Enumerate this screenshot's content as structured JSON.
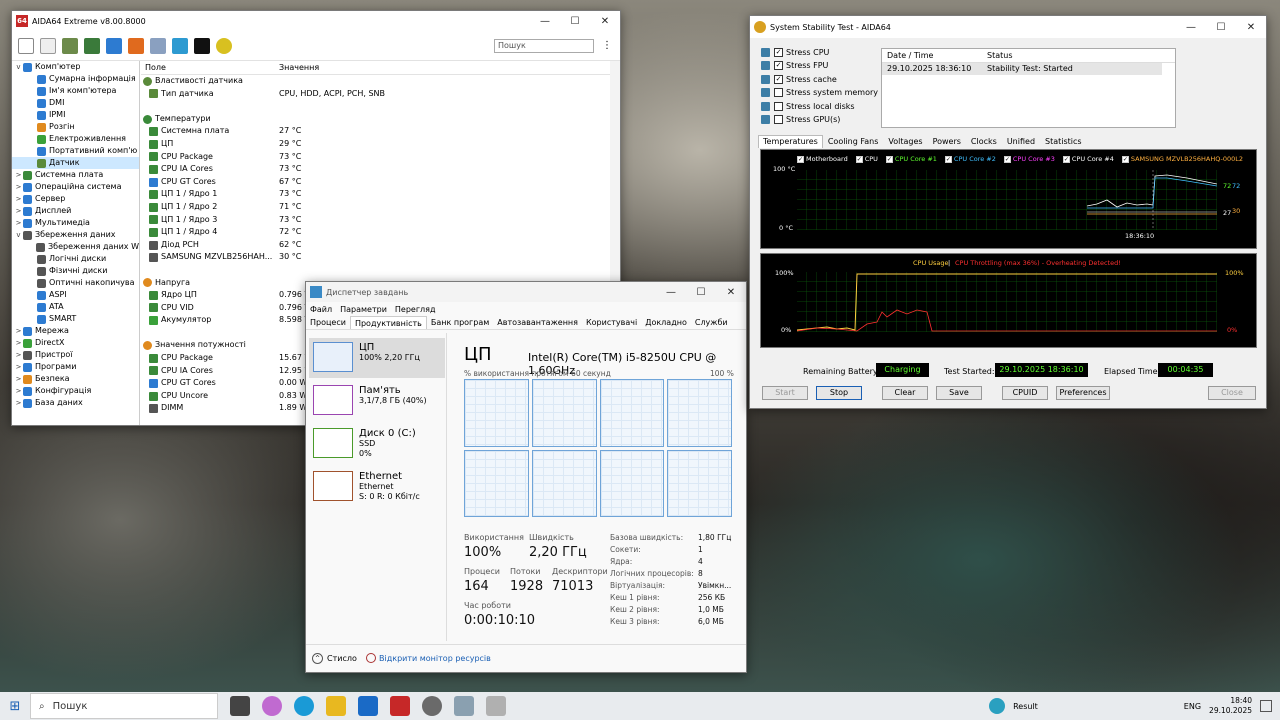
{
  "aida": {
    "title": "AIDA64 Extreme v8.00.8000",
    "logo": "64",
    "search_placeholder": "Пошук",
    "col_field": "Поле",
    "col_value": "Значення",
    "tree": [
      {
        "label": "Комп'ютер",
        "lvl": 0,
        "ex": "v",
        "color": "#2d7bd1"
      },
      {
        "label": "Сумарна інформація",
        "lvl": 1,
        "ex": "",
        "color": "#2d7bd1"
      },
      {
        "label": "Ім'я комп'ютера",
        "lvl": 1,
        "ex": "",
        "color": "#2d7bd1"
      },
      {
        "label": "DMI",
        "lvl": 1,
        "ex": "",
        "color": "#2d7bd1"
      },
      {
        "label": "IPMI",
        "lvl": 1,
        "ex": "",
        "color": "#2d7bd1"
      },
      {
        "label": "Розгін",
        "lvl": 1,
        "ex": "",
        "color": "#e08a1e"
      },
      {
        "label": "Електроживлення",
        "lvl": 1,
        "ex": "",
        "color": "#3aa13a"
      },
      {
        "label": "Портативний комп'ю",
        "lvl": 1,
        "ex": "",
        "color": "#2d7bd1"
      },
      {
        "label": "Датчик",
        "lvl": 1,
        "ex": "",
        "color": "#5a8a3a",
        "sel": true
      },
      {
        "label": "Системна плата",
        "lvl": 0,
        "ex": ">",
        "color": "#3a8a3a"
      },
      {
        "label": "Операційна система",
        "lvl": 0,
        "ex": ">",
        "color": "#2d7bd1"
      },
      {
        "label": "Сервер",
        "lvl": 0,
        "ex": ">",
        "color": "#2d7bd1"
      },
      {
        "label": "Дисплей",
        "lvl": 0,
        "ex": ">",
        "color": "#2d7bd1"
      },
      {
        "label": "Мультимедіа",
        "lvl": 0,
        "ex": ">",
        "color": "#2d7bd1"
      },
      {
        "label": "Збереження даних",
        "lvl": 0,
        "ex": "v",
        "color": "#555555"
      },
      {
        "label": "Збереження даних W",
        "lvl": 1,
        "ex": "",
        "color": "#555555"
      },
      {
        "label": "Логічні диски",
        "lvl": 1,
        "ex": "",
        "color": "#555555"
      },
      {
        "label": "Фізичні диски",
        "lvl": 1,
        "ex": "",
        "color": "#555555"
      },
      {
        "label": "Оптичні накопичува",
        "lvl": 1,
        "ex": "",
        "color": "#555555"
      },
      {
        "label": "ASPI",
        "lvl": 1,
        "ex": "",
        "color": "#2d7bd1"
      },
      {
        "label": "ATA",
        "lvl": 1,
        "ex": "",
        "color": "#2d7bd1"
      },
      {
        "label": "SMART",
        "lvl": 1,
        "ex": "",
        "color": "#2d7bd1"
      },
      {
        "label": "Мережа",
        "lvl": 0,
        "ex": ">",
        "color": "#2d7bd1"
      },
      {
        "label": "DirectX",
        "lvl": 0,
        "ex": ">",
        "color": "#3aa13a"
      },
      {
        "label": "Пристрої",
        "lvl": 0,
        "ex": ">",
        "color": "#555555"
      },
      {
        "label": "Програми",
        "lvl": 0,
        "ex": ">",
        "color": "#2d7bd1"
      },
      {
        "label": "Безпека",
        "lvl": 0,
        "ex": ">",
        "color": "#e08a1e"
      },
      {
        "label": "Конфігурація",
        "lvl": 0,
        "ex": ">",
        "color": "#2d7bd1"
      },
      {
        "label": "База даних",
        "lvl": 0,
        "ex": ">",
        "color": "#2d7bd1"
      }
    ],
    "rows": [
      {
        "f": "Властивості датчика",
        "v": "",
        "sec": true,
        "color": "#5a8a3a"
      },
      {
        "f": "Тип датчика",
        "v": "CPU, HDD, ACPI, PCH, SNB",
        "color": "#5a8a3a"
      },
      {
        "f": "",
        "v": ""
      },
      {
        "f": "Температури",
        "v": "",
        "sec": true,
        "color": "#3a8a3a"
      },
      {
        "f": "Системна плата",
        "v": "27 °C",
        "color": "#3a8a3a"
      },
      {
        "f": "ЦП",
        "v": "29 °C",
        "color": "#3a8a3a"
      },
      {
        "f": "CPU Package",
        "v": "73 °C",
        "color": "#3a8a3a"
      },
      {
        "f": "CPU IA Cores",
        "v": "73 °C",
        "color": "#3a8a3a"
      },
      {
        "f": "CPU GT Cores",
        "v": "67 °C",
        "color": "#2d7bd1"
      },
      {
        "f": "ЦП 1 / Ядро 1",
        "v": "73 °C",
        "color": "#3a8a3a"
      },
      {
        "f": "ЦП 1 / Ядро 2",
        "v": "71 °C",
        "color": "#3a8a3a"
      },
      {
        "f": "ЦП 1 / Ядро 3",
        "v": "73 °C",
        "color": "#3a8a3a"
      },
      {
        "f": "ЦП 1 / Ядро 4",
        "v": "72 °C",
        "color": "#3a8a3a"
      },
      {
        "f": "Діод PCH",
        "v": "62 °C",
        "color": "#555555"
      },
      {
        "f": "SAMSUNG MZVLB256HAH...",
        "v": "30 °C",
        "color": "#555555"
      },
      {
        "f": "",
        "v": ""
      },
      {
        "f": "Напруга",
        "v": "",
        "sec": true,
        "color": "#e08a1e"
      },
      {
        "f": "Ядро ЦП",
        "v": "0.796 V",
        "color": "#3a8a3a"
      },
      {
        "f": "CPU VID",
        "v": "0.796 V",
        "color": "#3a8a3a"
      },
      {
        "f": "Акумулятор",
        "v": "8.598 V",
        "color": "#3aa13a"
      },
      {
        "f": "",
        "v": ""
      },
      {
        "f": "Значення потужності",
        "v": "",
        "sec": true,
        "color": "#e08a1e"
      },
      {
        "f": "CPU Package",
        "v": "15.67 W",
        "color": "#3a8a3a"
      },
      {
        "f": "CPU IA Cores",
        "v": "12.95 W",
        "color": "#3a8a3a"
      },
      {
        "f": "CPU GT Cores",
        "v": "0.00 W",
        "color": "#2d7bd1"
      },
      {
        "f": "CPU Uncore",
        "v": "0.83 W",
        "color": "#3a8a3a"
      },
      {
        "f": "DIMM",
        "v": "1.89 W",
        "color": "#555555"
      }
    ]
  },
  "taskmgr": {
    "title": "Диспетчер завдань",
    "menu": [
      "Файл",
      "Параметри",
      "Перегляд"
    ],
    "tabs": [
      "Процеси",
      "Продуктивність",
      "Банк програм",
      "Автозавантаження",
      "Користувачі",
      "Докладно",
      "Служби"
    ],
    "active_tab": 1,
    "resources": [
      {
        "name": "ЦП",
        "sub1": "100%  2,20 ГГц",
        "sub2": "",
        "sub3": "",
        "color": "#5a8fd0"
      },
      {
        "name": "Пам'ять",
        "sub1": "3,1/7,8 ГБ (40%)",
        "sub2": "",
        "sub3": "",
        "color": "#9a45b0"
      },
      {
        "name": "Диск 0 (C:)",
        "sub1": "SSD",
        "sub2": "0%",
        "sub3": "",
        "color": "#4a9a2a"
      },
      {
        "name": "Ethernet",
        "sub1": "Ethernet",
        "sub2": "S: 0 R: 0 Кбіт/с",
        "sub3": "",
        "color": "#a0522d"
      }
    ],
    "heading": "ЦП",
    "cpu_name": "Intel(R) Core(TM) i5-8250U CPU @ 1.60GHz",
    "usage_label": "% використання протягом 60 секунд",
    "usage_max": "100 %",
    "stats": {
      "usage_l": "Використання",
      "usage_v": "100%",
      "speed_l": "Швидкість",
      "speed_v": "2,20 ГГц",
      "proc_l": "Процеси",
      "proc_v": "164",
      "thr_l": "Потоки",
      "thr_v": "1928",
      "hnd_l": "Дескриптори",
      "hnd_v": "71013",
      "up_l": "Час роботи",
      "up_v": "0:00:10:10"
    },
    "specs": [
      [
        "Базова швидкість:",
        "1,80 ГГц"
      ],
      [
        "Сокети:",
        "1"
      ],
      [
        "Ядра:",
        "4"
      ],
      [
        "Логічних процесорів:",
        "8"
      ],
      [
        "Віртуалізація:",
        "Увімкн..."
      ],
      [
        "Кеш 1 рівня:",
        "256 КБ"
      ],
      [
        "Кеш 2 рівня:",
        "1,0 МБ"
      ],
      [
        "Кеш 3 рівня:",
        "6,0 МБ"
      ]
    ],
    "less": "Стисло",
    "monitor": "Відкрити монітор ресурсів"
  },
  "sst": {
    "title": "System Stability Test - AIDA64",
    "checks": [
      {
        "l": "Stress CPU",
        "c": true
      },
      {
        "l": "Stress FPU",
        "c": true
      },
      {
        "l": "Stress cache",
        "c": true
      },
      {
        "l": "Stress system memory",
        "c": false
      },
      {
        "l": "Stress local disks",
        "c": false
      },
      {
        "l": "Stress GPU(s)",
        "c": false
      }
    ],
    "log_h1": "Date / Time",
    "log_h2": "Status",
    "log_d": "29.10.2025 18:36:10",
    "log_s": "Stability Test: Started",
    "tabs": [
      "Temperatures",
      "Cooling Fans",
      "Voltages",
      "Powers",
      "Clocks",
      "Unified",
      "Statistics"
    ],
    "legend": [
      {
        "l": "Motherboard",
        "c": "#ffffff"
      },
      {
        "l": "CPU",
        "c": "#ffffff"
      },
      {
        "l": "CPU Core #1",
        "c": "#60ff30"
      },
      {
        "l": "CPU Core #2",
        "c": "#40c0ff"
      },
      {
        "l": "CPU Core #3",
        "c": "#ff40ff"
      },
      {
        "l": "CPU Core #4",
        "c": "#ffffff"
      },
      {
        "l": "SAMSUNG MZVLB256HAHQ-000L2",
        "c": "#ffb040"
      }
    ],
    "t_top": "100 °C",
    "t_bot": "0 °C",
    "t_time": "18:36:10",
    "t_r1": "72",
    "t_r2": "72",
    "t_r3": "27",
    "t_r4": "30",
    "u_title": "CPU Usage",
    "u_sep": "|",
    "u_throttle": "CPU Throttling (max 36%) - Overheating Detected!",
    "u_top": "100%",
    "u_bot": "0%",
    "u_rtop": "100%",
    "u_rbot": "0%",
    "battery_l": "Remaining Battery:",
    "battery_v": "Charging",
    "started_l": "Test Started:",
    "started_v": "29.10.2025 18:36:10",
    "elapsed_l": "Elapsed Time:",
    "elapsed_v": "00:04:35",
    "buttons": [
      "Start",
      "Stop",
      "Clear",
      "Save",
      "CPUID",
      "Preferences",
      "Close"
    ]
  },
  "taskbar": {
    "search": "Пошук",
    "weather": "Result",
    "lang": "ENG",
    "time": "18:40",
    "date": "29.10.2025"
  }
}
